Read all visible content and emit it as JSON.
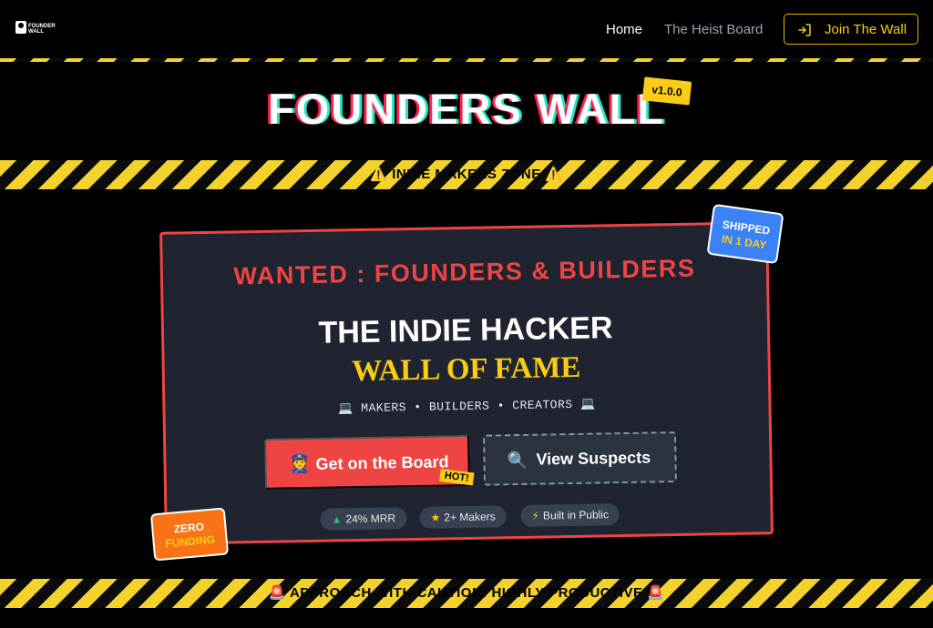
{
  "nav": {
    "logo_lines": [
      "FOUNDER",
      "WALL"
    ],
    "home": "Home",
    "heist_board": "The Heist Board",
    "join": "Join The Wall",
    "join_icon": "login-icon"
  },
  "hero": {
    "title": "FOUNDERS WALL",
    "version": "v1.0.0",
    "zone_text": "⚠️ INDIE MAKERS ZONE ⚠️"
  },
  "poster": {
    "wanted": "WANTED : FOUNDERS & BUILDERS",
    "headline": "THE INDIE HACKER",
    "subheadline": "WALL OF FAME",
    "tagline": "💻 MAKERS • BUILDERS • CREATORS 💻",
    "primary_button": {
      "icon": "👮",
      "label": "Get on the Board"
    },
    "hot_badge": "HOT!",
    "secondary_button": {
      "icon": "🔍",
      "label": "View Suspects"
    },
    "pills": [
      {
        "icon": "▲",
        "label": "24% MRR"
      },
      {
        "icon": "★",
        "label": "2+ Makers"
      },
      {
        "icon": "⚡",
        "label": "Built in Public"
      }
    ]
  },
  "stamps": {
    "shipped_line1": "SHIPPED",
    "shipped_line2": "IN 1 DAY",
    "zero_line1": "ZERO",
    "zero_line2": "FUNDING"
  },
  "footer_band_text": "🚨 APPROACH WITH CAUTION: HIGHLY PRODUCTIVE 🚨",
  "colors": {
    "accent_yellow": "#facc15",
    "accent_red": "#ef4444",
    "stamp_blue": "#3b82f6",
    "stamp_orange": "#f97316",
    "poster_bg": "#1f2430"
  }
}
